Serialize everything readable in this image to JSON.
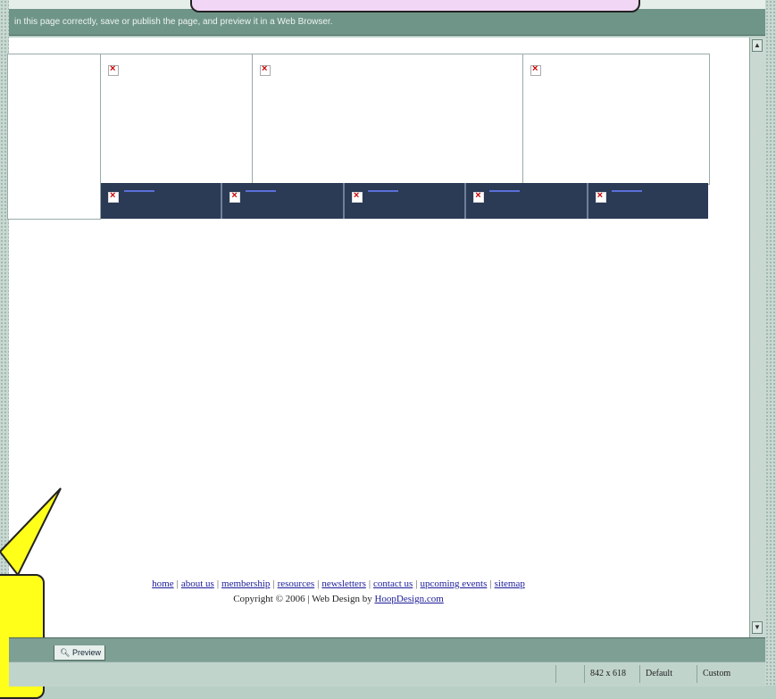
{
  "infobar": {
    "message": "in this page correctly, save or publish the page, and preview it in a Web Browser."
  },
  "footer": {
    "links": [
      "home",
      "about us",
      "membership",
      "resources",
      "newsletters",
      "contact us",
      "upcoming events",
      "sitemap"
    ],
    "separator": "|",
    "copyright_prefix": "Copyright © 2006  |  Web Design by ",
    "copyright_link": "HoopDesign.com"
  },
  "tabs": {
    "preview_label": "Preview"
  },
  "statusbar": {
    "dimensions": "842 x 618",
    "default_label": "Default",
    "custom_label": "Custom"
  },
  "colors": {
    "nav_background": "#2b3a55",
    "info_bar": "#6f9589",
    "callout_yellow": "#ffff1a",
    "callout_pink": "#f2d6f5"
  },
  "icons": {
    "broken_image": "broken-image-icon",
    "preview": "magnifier-icon"
  }
}
